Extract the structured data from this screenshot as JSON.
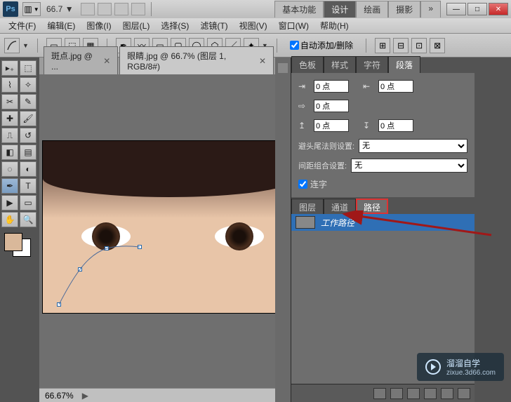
{
  "title": {
    "zoom_text": "66.7",
    "arrow": "▼"
  },
  "workspace": {
    "tabs": [
      "基本功能",
      "设计",
      "绘画",
      "摄影"
    ],
    "more": "»",
    "active_index": 1
  },
  "window_controls": {
    "min": "—",
    "max": "□",
    "close": "✕"
  },
  "menubar": [
    "文件(F)",
    "编辑(E)",
    "图像(I)",
    "图层(L)",
    "选择(S)",
    "滤镜(T)",
    "视图(V)",
    "窗口(W)",
    "帮助(H)"
  ],
  "optionsbar": {
    "auto_add_delete": "自动添加/删除",
    "checked": true
  },
  "doc_tabs": {
    "items": [
      {
        "label": "斑点.jpg @ ...",
        "close": "✕"
      },
      {
        "label": "眼睛.jpg @ 66.7% (图层 1, RGB/8#)",
        "close": "✕"
      }
    ],
    "active_index": 1
  },
  "statusbar": {
    "zoom": "66.67%",
    "arrow": "▶"
  },
  "paragraph_panel": {
    "tabs": [
      "色板",
      "样式",
      "字符",
      "段落"
    ],
    "active_index": 3,
    "left_indent": "0 点",
    "right_indent": "0 点",
    "first_line": "0 点",
    "space_before": "0 点",
    "space_after": "0 点",
    "avoid_label": "避头尾法则设置:",
    "avoid_value": "无",
    "spacing_label": "间距组合设置:",
    "spacing_value": "无",
    "ligature": "连字",
    "ligature_checked": true
  },
  "layers_panel": {
    "tabs": [
      "图层",
      "通道",
      "路径"
    ],
    "active_index": 2,
    "items": [
      {
        "name": "工作路径"
      }
    ]
  },
  "swatch": {
    "fg": "#d9b89a",
    "bg": "#ffffff"
  },
  "watermark": {
    "text1": "溜溜自学",
    "text2": "zixue.3d66.com"
  }
}
